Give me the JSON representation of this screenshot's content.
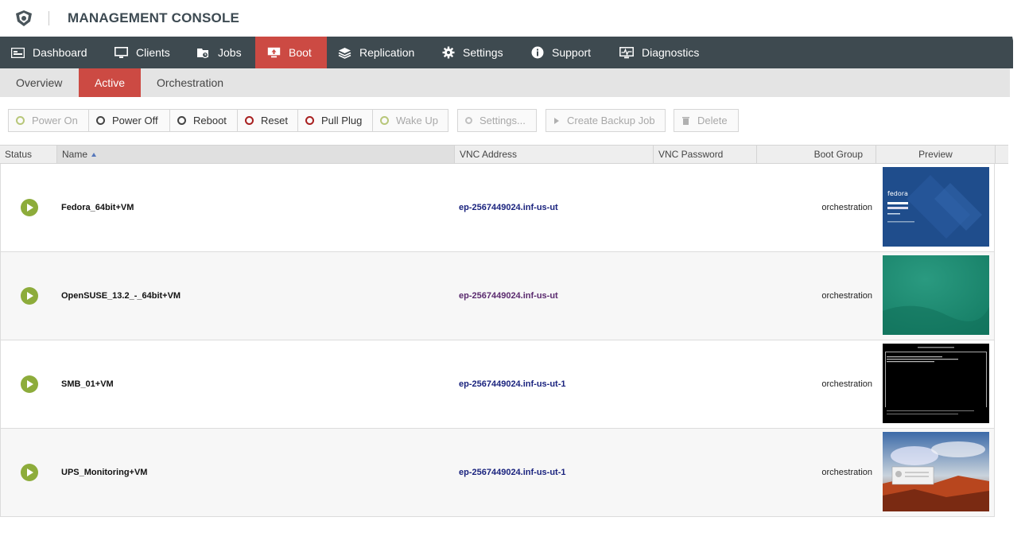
{
  "header": {
    "title": "MANAGEMENT CONSOLE",
    "logo_icon": "shield-logo-icon"
  },
  "colors": {
    "nav_bg": "#3e4a50",
    "accent": "#cc4a43",
    "status_running": "#8dac3b",
    "link": "#1a237e"
  },
  "mainnav": [
    {
      "label": "Dashboard",
      "icon": "dashboard-icon"
    },
    {
      "label": "Clients",
      "icon": "monitor-icon"
    },
    {
      "label": "Jobs",
      "icon": "jobs-icon"
    },
    {
      "label": "Boot",
      "icon": "boot-icon",
      "active": true
    },
    {
      "label": "Replication",
      "icon": "layers-icon"
    },
    {
      "label": "Settings",
      "icon": "gear-icon"
    },
    {
      "label": "Support",
      "icon": "info-icon"
    },
    {
      "label": "Diagnostics",
      "icon": "pulse-icon"
    }
  ],
  "subnav": [
    {
      "label": "Overview"
    },
    {
      "label": "Active",
      "active": true
    },
    {
      "label": "Orchestration"
    }
  ],
  "toolbar": [
    {
      "label": "Power On",
      "enabled": false
    },
    {
      "label": "Power Off",
      "enabled": true
    },
    {
      "label": "Reboot",
      "enabled": true
    },
    {
      "label": "Reset",
      "enabled": true
    },
    {
      "label": "Pull Plug",
      "enabled": true
    },
    {
      "label": "Wake Up",
      "enabled": false
    },
    {
      "label": "Settings...",
      "enabled": false
    },
    {
      "label": "Create Backup Job",
      "enabled": false
    },
    {
      "label": "Delete",
      "enabled": false
    }
  ],
  "table": {
    "columns": [
      "Status",
      "Name",
      "VNC Address",
      "VNC Password",
      "Boot Group",
      "Preview"
    ],
    "sorted_column": "Name",
    "rows": [
      {
        "status": "running",
        "name": "Fedora_64bit+VM",
        "vnc_address": "ep-2567449024.inf-us-ut",
        "vnc_password": "",
        "boot_group": "orchestration",
        "preview": "fedora-login-screen"
      },
      {
        "status": "running",
        "name": "OpenSUSE_13.2_-_64bit+VM",
        "vnc_address": "ep-2567449024.inf-us-ut",
        "vnc_password": "",
        "boot_group": "orchestration",
        "preview": "opensuse-green-desktop"
      },
      {
        "status": "running",
        "name": "SMB_01+VM",
        "vnc_address": "ep-2567449024.inf-us-ut-1",
        "vnc_password": "",
        "boot_group": "orchestration",
        "preview": "black-console-screen"
      },
      {
        "status": "running",
        "name": "UPS_Monitoring+VM",
        "vnc_address": "ep-2567449024.inf-us-ut-1",
        "vnc_password": "",
        "boot_group": "orchestration",
        "preview": "landscape-desktop-dialog"
      }
    ]
  }
}
